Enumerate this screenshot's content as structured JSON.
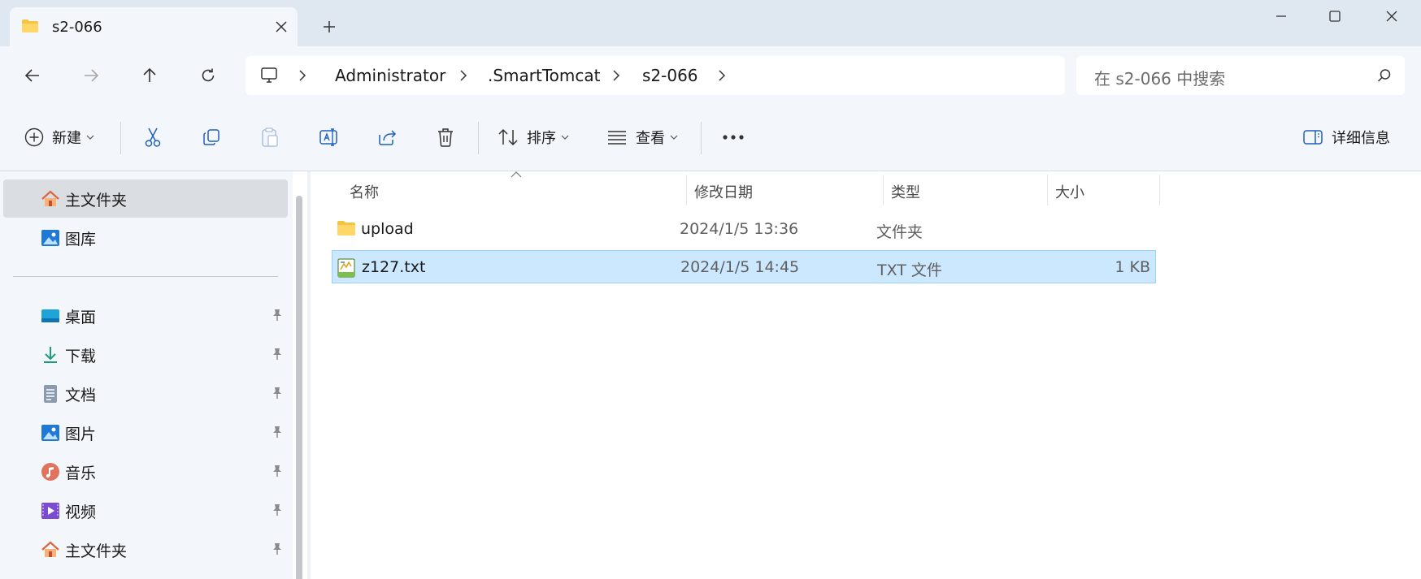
{
  "window": {
    "tab_title": "s2-066",
    "tab_icon": "folder-icon",
    "controls": [
      "minimize-icon",
      "maximize-icon",
      "close-icon"
    ]
  },
  "address": {
    "breadcrumb": [
      "Administrator",
      ".SmartTomcat",
      "s2-066"
    ],
    "search_placeholder": "在 s2-066 中搜索"
  },
  "commands": {
    "new_label": "新建",
    "sort_label": "排序",
    "view_label": "查看",
    "details_label": "详细信息"
  },
  "sidebar": {
    "top_items": [
      {
        "label": "主文件夹",
        "icon": "home-icon",
        "selected": true
      },
      {
        "label": "图库",
        "icon": "gallery-icon"
      }
    ],
    "pinned_items": [
      {
        "label": "桌面",
        "icon": "desktop-icon"
      },
      {
        "label": "下载",
        "icon": "download-icon"
      },
      {
        "label": "文档",
        "icon": "document-icon"
      },
      {
        "label": "图片",
        "icon": "pictures-icon"
      },
      {
        "label": "音乐",
        "icon": "music-icon"
      },
      {
        "label": "视频",
        "icon": "video-icon"
      },
      {
        "label": "主文件夹",
        "icon": "home-icon"
      }
    ]
  },
  "files": {
    "columns": {
      "name": "名称",
      "date": "修改日期",
      "type": "类型",
      "size": "大小"
    },
    "rows": [
      {
        "name": "upload",
        "date": "2024/1/5 13:36",
        "type": "文件夹",
        "size": "",
        "icon": "folder-icon",
        "selected": false
      },
      {
        "name": "z127.txt",
        "date": "2024/1/5 14:45",
        "type": "TXT 文件",
        "size": "1 KB",
        "icon": "text-file-icon",
        "selected": true
      }
    ]
  },
  "colors": {
    "chrome_bg": "#f3f6fa",
    "titlebar_bg": "#dfe7f1",
    "selection_bg": "#cce8ff",
    "selection_border": "#99d1ff",
    "accent": "#0067c0"
  }
}
